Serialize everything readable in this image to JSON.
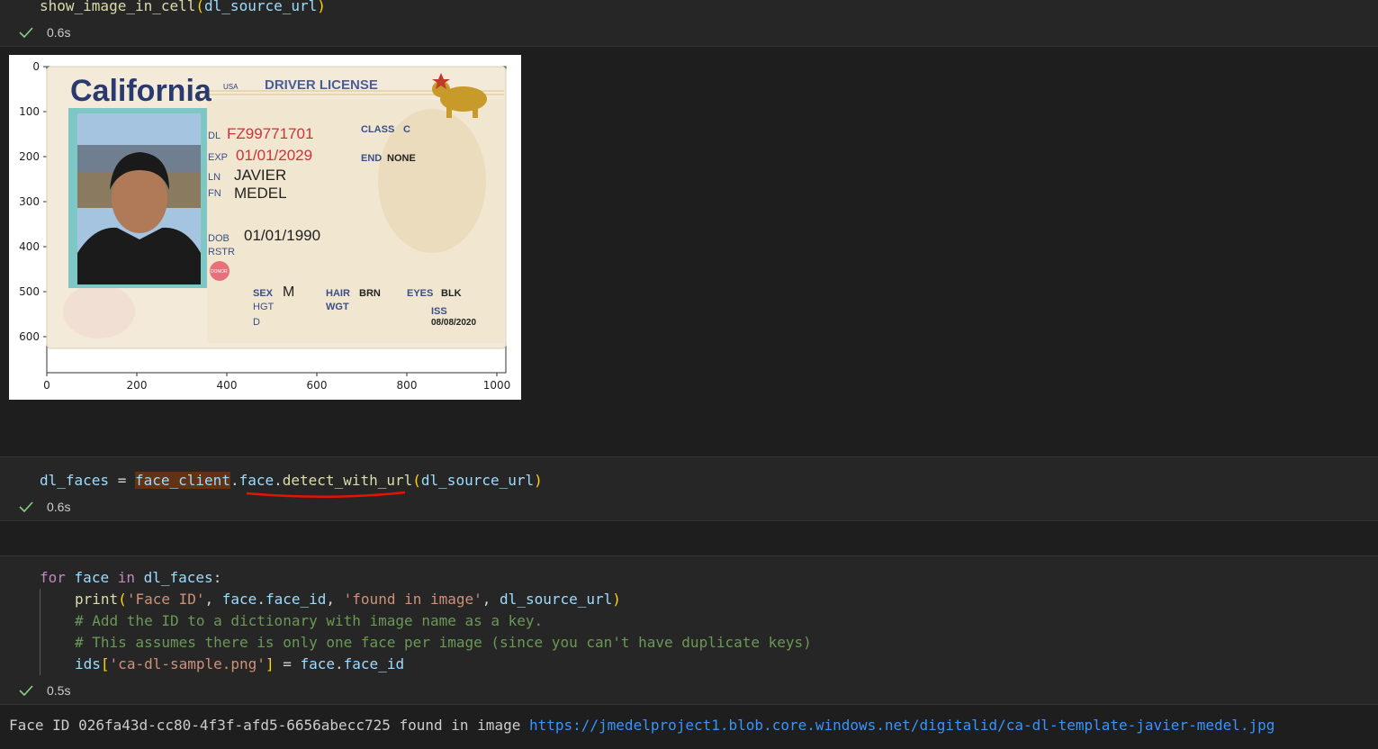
{
  "cell1": {
    "code_fn": "show_image_in_cell",
    "code_arg": "dl_source_url",
    "status_time": "0.6s"
  },
  "chart_data": {
    "type": "image",
    "x_ticks": [
      "0",
      "200",
      "400",
      "600",
      "800",
      "1000"
    ],
    "y_ticks": [
      "0",
      "100",
      "200",
      "300",
      "400",
      "500",
      "600"
    ],
    "xlim": [
      0,
      1020
    ],
    "ylim": [
      680,
      0
    ]
  },
  "card": {
    "state": "California",
    "usa": "USA",
    "doc_type": "DRIVER LICENSE",
    "dl_label": "DL",
    "dl_number": "FZ99771701",
    "exp_label": "EXP",
    "exp_date": "01/01/2029",
    "ln_label": "LN",
    "last_name": "JAVIER",
    "fn_label": "FN",
    "first_name": "MEDEL",
    "dob_label": "DOB",
    "dob": "01/01/1990",
    "rstr_label": "RSTR",
    "class_label": "CLASS",
    "class_value": "C",
    "end_label": "END",
    "end_value": "NONE",
    "sex_label": "SEX",
    "sex_value": "M",
    "hgt_label": "HGT",
    "hair_label": "HAIR",
    "hair_value": "BRN",
    "wgt_label": "WGT",
    "eyes_label": "EYES",
    "eyes_value": "BLK",
    "d_label": "D",
    "iss_label": "ISS",
    "iss_date": "08/08/2020",
    "donor": "DONOR"
  },
  "cell2": {
    "var": "dl_faces",
    "op": "=",
    "obj": "face_client",
    "attr": "face",
    "method": "detect_with_url",
    "arg": "dl_source_url",
    "status_time": "0.6s"
  },
  "cell3": {
    "kw_for": "for",
    "loop_var": "face",
    "kw_in": "in",
    "iterable": "dl_faces",
    "print_fn": "print",
    "str1": "'Face ID'",
    "face_obj": "face",
    "face_id_attr": "face_id",
    "str2": "'found in image'",
    "url_var": "dl_source_url",
    "comment1": "# Add the ID to a dictionary with image name as a key.",
    "comment2": "# This assumes there is only one face per image (since you can't have duplicate keys)",
    "dict_var": "ids",
    "dict_key": "'ca-dl-sample.png'",
    "status_time": "0.5s"
  },
  "output": {
    "prefix": "Face ID 026fa43d-cc80-4f3f-afd5-6656abecc725 found in image ",
    "url": "https://jmedelproject1.blob.core.windows.net/digitalid/ca-dl-template-javier-medel.jpg"
  },
  "colors": {
    "background": "#1e1e1e",
    "cell_background": "#262626",
    "keyword": "#c586c0",
    "variable": "#9cdcfe",
    "function": "#dcdcaa",
    "string": "#ce9178",
    "comment": "#6a9955",
    "link": "#3794ff",
    "check": "#89d185"
  },
  "icons": [
    "check-icon"
  ]
}
